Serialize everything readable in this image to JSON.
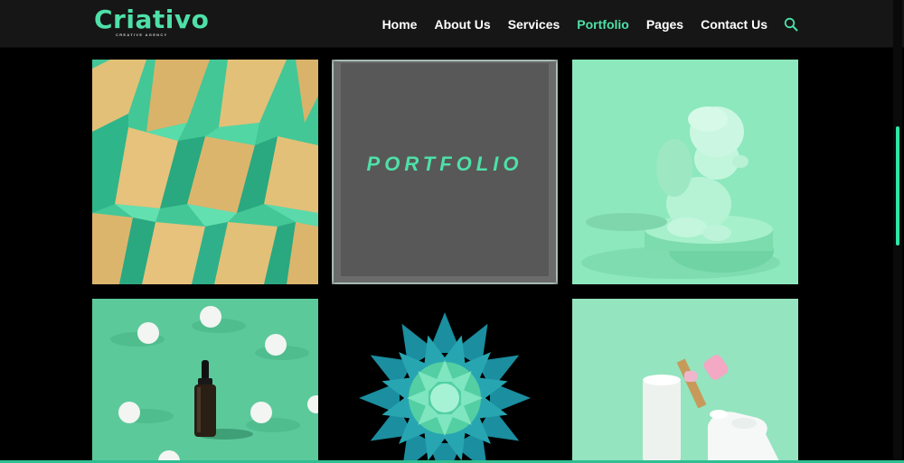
{
  "brand": {
    "name": "Criativo",
    "tagline": "CREATIVE AGENCY",
    "accent_color": "#4ee0a8"
  },
  "nav": {
    "items": [
      {
        "label": "Home",
        "active": false
      },
      {
        "label": "About Us",
        "active": false
      },
      {
        "label": "Services",
        "active": false
      },
      {
        "label": "Portfolio",
        "active": true
      },
      {
        "label": "Pages",
        "active": false
      },
      {
        "label": "Contact Us",
        "active": false
      }
    ],
    "search_icon": "search-icon"
  },
  "portfolio": {
    "overlay_label": "PORTFOLIO",
    "tiles": [
      {
        "subject": "green and gold origami pattern"
      },
      {
        "subject": "portfolio title card"
      },
      {
        "subject": "cherub statue on pedestal"
      },
      {
        "subject": "dropper bottle with white spheres"
      },
      {
        "subject": "teal paper flower"
      },
      {
        "subject": "hand with face roller and tube"
      }
    ]
  }
}
